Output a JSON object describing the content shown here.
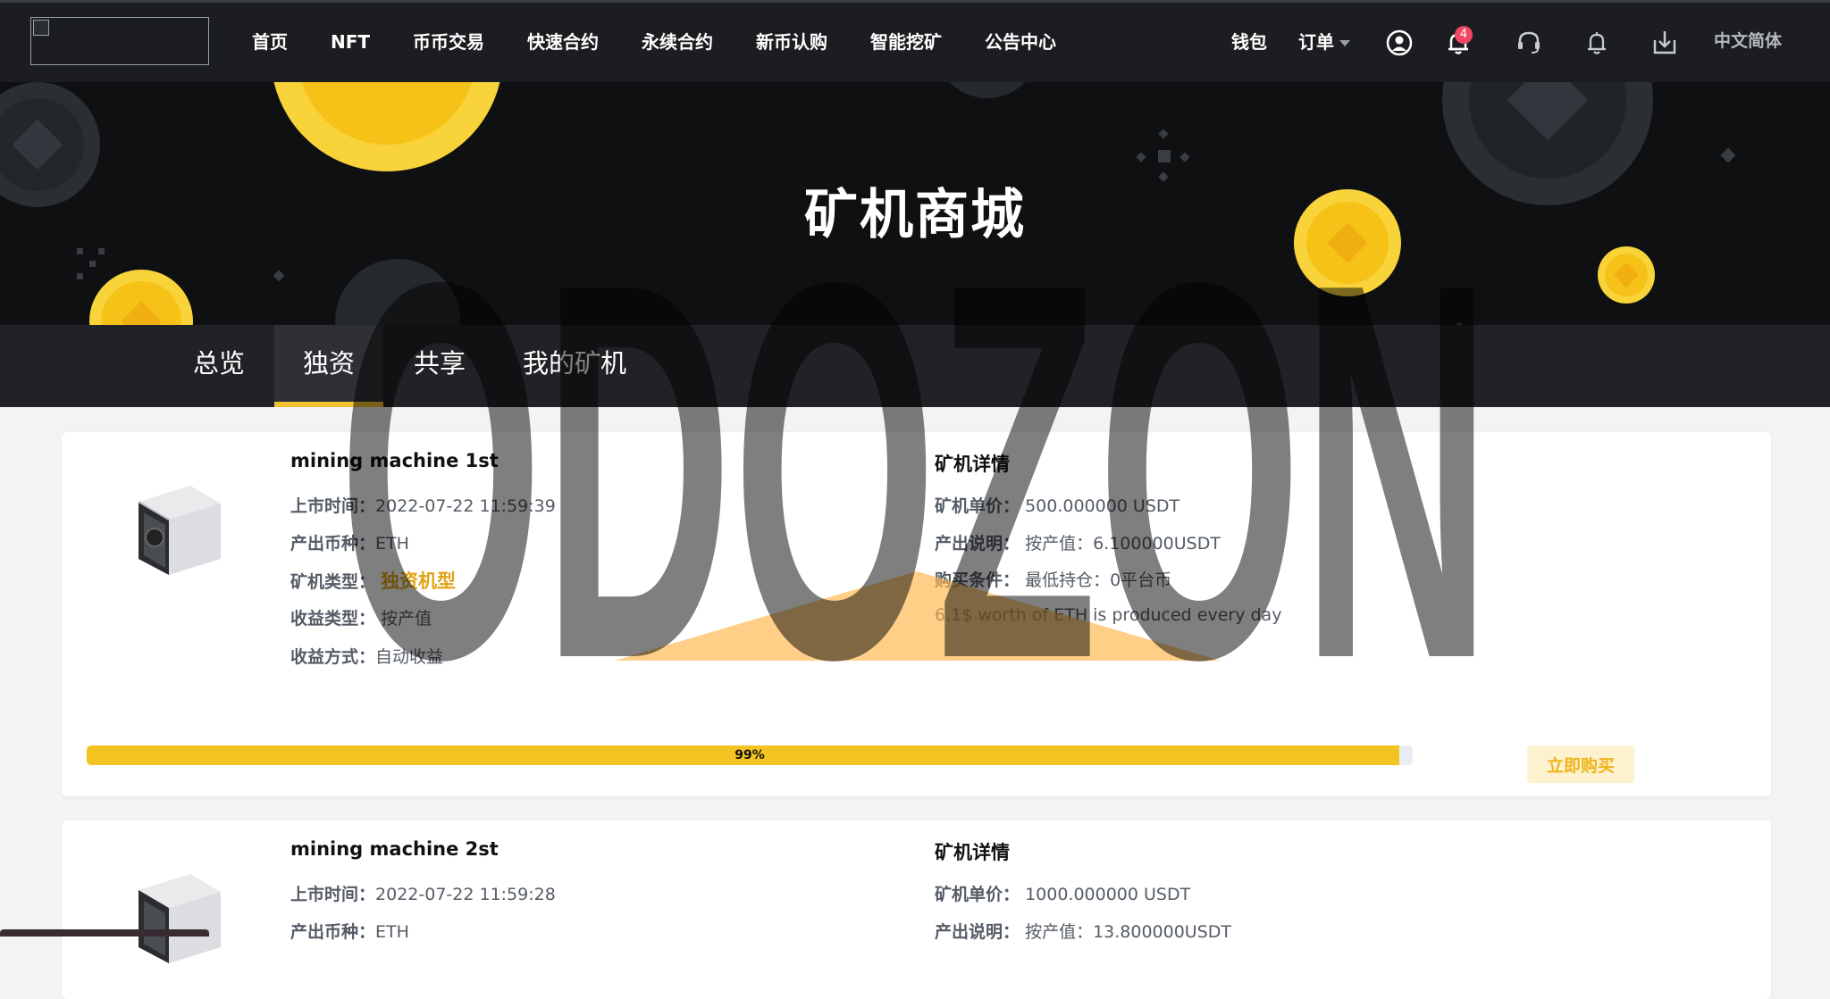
{
  "nav": {
    "items": [
      "首页",
      "NFT",
      "币币交易",
      "快速合约",
      "永续合约",
      "新币认购",
      "智能挖矿",
      "公告中心"
    ],
    "wallet": "钱包",
    "orders": "订单",
    "notification_count": "4",
    "language": "中文简体"
  },
  "hero": {
    "title": "矿机商城"
  },
  "tabs": [
    {
      "label": "总览",
      "active": false
    },
    {
      "label": "独资",
      "active": true
    },
    {
      "label": "共享",
      "active": false
    },
    {
      "label": "我的矿机",
      "active": false
    }
  ],
  "cards": [
    {
      "title": "mining machine 1st",
      "rows": [
        {
          "label": "上市时间：",
          "value": "2022-07-22 11:59:39"
        },
        {
          "label": "产出币种：",
          "value": "ETH"
        },
        {
          "label": "矿机类型：",
          "value": "独资机型"
        },
        {
          "label": "收益类型：",
          "value": "按产值"
        },
        {
          "label": "收益方式：",
          "value": "自动收益"
        }
      ],
      "detail_title": "矿机详情",
      "details": [
        {
          "label": "矿机单价：",
          "value": "500.000000 USDT"
        },
        {
          "label": "产出说明：",
          "value": "按产值：6.100000USDT"
        },
        {
          "label": "购买条件：",
          "value": "最低持仓：0平台币"
        },
        {
          "label": "",
          "value": "6.1$ worth of ETH is produced every day"
        }
      ],
      "progress_percent": 99,
      "progress_label": "99%",
      "buy_label": "立即购买"
    },
    {
      "title": "mining machine 2st",
      "rows": [
        {
          "label": "上市时间：",
          "value": "2022-07-22 11:59:28"
        },
        {
          "label": "产出币种：",
          "value": "ETH"
        }
      ],
      "detail_title": "矿机详情",
      "details": [
        {
          "label": "矿机单价：",
          "value": "1000.000000 USDT"
        },
        {
          "label": "产出说明：",
          "value": "按产值：13.800000USDT"
        }
      ]
    }
  ],
  "watermark_text": "ODOZON",
  "colors": {
    "accent_yellow": "#f3c321",
    "nav_bg": "#1b1d20",
    "hero_bg": "#0f1012",
    "badge_red": "#f04864",
    "buy_text": "#f0b419"
  }
}
